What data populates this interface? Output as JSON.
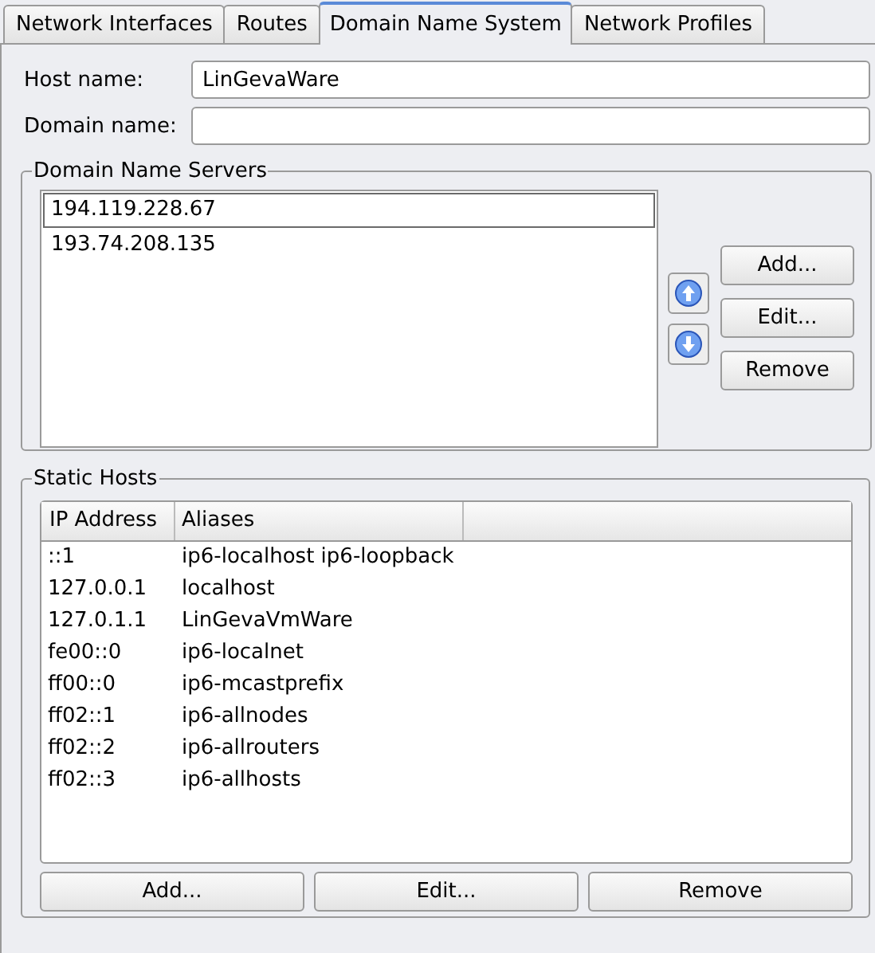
{
  "tabs": [
    {
      "label": "Network Interfaces",
      "selected": false
    },
    {
      "label": "Routes",
      "selected": false
    },
    {
      "label": "Domain Name System",
      "selected": true
    },
    {
      "label": "Network Profiles",
      "selected": false
    }
  ],
  "host_name": {
    "label": "Host name:",
    "value": "LinGevaWare"
  },
  "domain_name": {
    "label": "Domain name:"
  },
  "dns_servers": {
    "title": "Domain Name Servers",
    "items": [
      {
        "text": "194.119.228.67",
        "selected": true
      },
      {
        "text": "193.74.208.135",
        "selected": false
      }
    ],
    "buttons": [
      "Add...",
      "Edit...",
      "Remove"
    ]
  },
  "static_hosts": {
    "title": "Static Hosts",
    "columns": [
      "IP Address",
      "Aliases"
    ],
    "rows": [
      [
        "::1",
        "ip6-localhost ip6-loopback"
      ],
      [
        "127.0.0.1",
        "localhost"
      ],
      [
        "127.0.1.1",
        "LinGevaVmWare"
      ],
      [
        "fe00::0",
        "ip6-localnet"
      ],
      [
        "ff00::0",
        "ip6-mcastprefix"
      ],
      [
        "ff02::1",
        "ip6-allnodes"
      ],
      [
        "ff02::2",
        "ip6-allrouters"
      ],
      [
        "ff02::3",
        "ip6-allhosts"
      ]
    ],
    "buttons": [
      "Add...",
      "Edit...",
      "Remove"
    ]
  }
}
